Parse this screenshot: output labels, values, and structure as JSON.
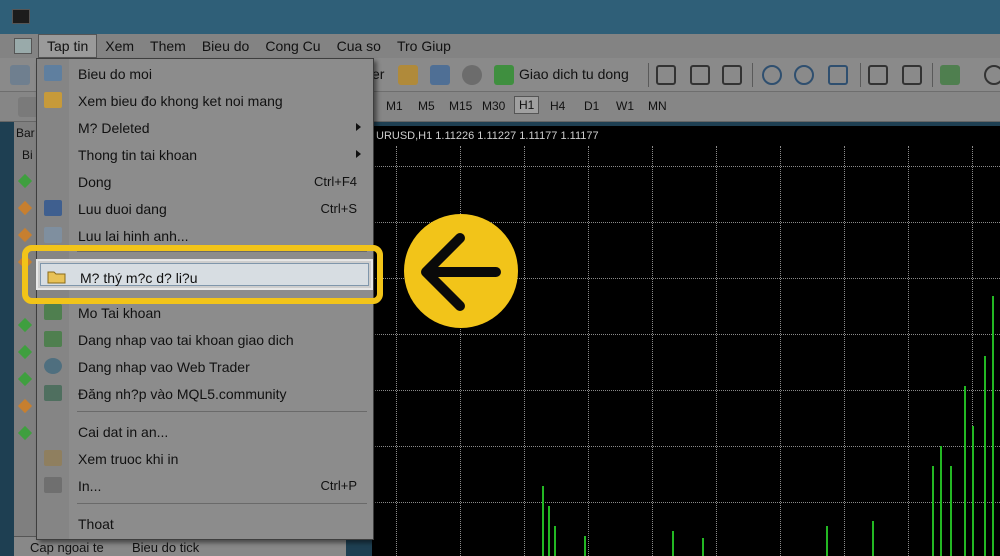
{
  "menubar": {
    "items": [
      "Tap tin",
      "Xem",
      "Them",
      "Bieu do",
      "Cong Cu",
      "Cua so",
      "Tro Giup"
    ]
  },
  "toolbar": {
    "partial_label": "er",
    "autotrade_label": "Giao dich tu dong"
  },
  "timeframes": [
    "M1",
    "M5",
    "M15",
    "M30",
    "H1",
    "H4",
    "D1",
    "W1",
    "MN"
  ],
  "timeframe_selected": "H1",
  "left_panel": {
    "header_partial": "Bar",
    "col_partial": "Bi",
    "tabs": [
      "Cap ngoai te",
      "Bieu do tick"
    ]
  },
  "chart": {
    "label": "URUSD,H1  1.11226 1.11227 1.11177 1.11177",
    "background_color": "#000000",
    "bar_color": "#23b823"
  },
  "file_menu": {
    "items": [
      {
        "label": "Bieu do moi",
        "shortcut": "",
        "submenu": false,
        "icon": "new-chart-icon"
      },
      {
        "label": "Xem bieu đo khong ket noi mang",
        "shortcut": "",
        "submenu": false,
        "icon": "open-offline-icon"
      },
      {
        "label": "M? Deleted",
        "shortcut": "",
        "submenu": true,
        "icon": ""
      },
      {
        "label": "Thong tin tai khoan",
        "shortcut": "",
        "submenu": true,
        "icon": ""
      },
      {
        "label": "Dong",
        "shortcut": "Ctrl+F4",
        "submenu": false,
        "icon": ""
      },
      {
        "label": "Luu duoi dang",
        "shortcut": "Ctrl+S",
        "submenu": false,
        "icon": "save-icon"
      },
      {
        "label": "Luu lai hinh anh...",
        "shortcut": "",
        "submenu": false,
        "icon": "save-picture-icon"
      },
      {
        "label": "M? thý m?c d? li?u",
        "shortcut": "",
        "submenu": false,
        "icon": "folder-icon"
      },
      {
        "label": "Mo Tai khoan",
        "shortcut": "",
        "submenu": false,
        "icon": "open-account-icon"
      },
      {
        "label": "Dang nhap vao tai khoan giao dich",
        "shortcut": "",
        "submenu": false,
        "icon": "login-icon"
      },
      {
        "label": "Dang nhap vao Web Trader",
        "shortcut": "",
        "submenu": false,
        "icon": "web-trader-icon"
      },
      {
        "label": "Đăng nh?p vào MQL5.community",
        "shortcut": "",
        "submenu": false,
        "icon": "mql5-icon"
      },
      {
        "label": "Cai dat in an...",
        "shortcut": "",
        "submenu": false,
        "icon": ""
      },
      {
        "label": "Xem truoc khi in",
        "shortcut": "",
        "submenu": false,
        "icon": "print-preview-icon"
      },
      {
        "label": "In...",
        "shortcut": "Ctrl+P",
        "submenu": false,
        "icon": "print-icon"
      },
      {
        "label": "Thoat",
        "shortcut": "",
        "submenu": false,
        "icon": ""
      }
    ],
    "highlighted_index": 7
  },
  "annotation": {
    "highlight_color": "#f2c419",
    "arrow_icon": "arrow-left-icon"
  }
}
